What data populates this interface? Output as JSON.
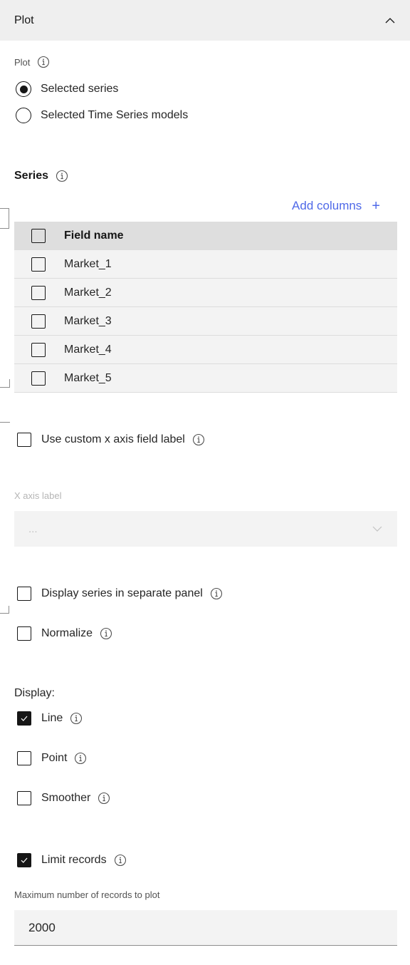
{
  "accordion": {
    "title": "Plot",
    "expanded": true,
    "toggle_icon": "chevron-up-icon"
  },
  "plot_group": {
    "label": "Plot",
    "info_icon": "info-icon",
    "options": [
      {
        "label": "Selected series",
        "selected": true
      },
      {
        "label": "Selected Time Series models",
        "selected": false
      }
    ]
  },
  "series": {
    "heading": "Series",
    "info_icon": "info-icon",
    "add_columns_label": "Add columns",
    "add_columns_icon": "plus-icon",
    "table": {
      "header": "Field name",
      "header_checked": false,
      "rows": [
        {
          "name": "Market_1",
          "checked": false
        },
        {
          "name": "Market_2",
          "checked": false
        },
        {
          "name": "Market_3",
          "checked": false
        },
        {
          "name": "Market_4",
          "checked": false
        },
        {
          "name": "Market_5",
          "checked": false
        }
      ]
    }
  },
  "custom_x_axis": {
    "label": "Use custom x axis field label",
    "checked": false
  },
  "x_axis_label": {
    "label": "X axis label",
    "placeholder": "...",
    "disabled": true
  },
  "separate_panel": {
    "label": "Display series in separate panel",
    "checked": false
  },
  "normalize": {
    "label": "Normalize",
    "checked": false
  },
  "display": {
    "label": "Display:",
    "options": [
      {
        "label": "Line",
        "checked": true
      },
      {
        "label": "Point",
        "checked": false
      },
      {
        "label": "Smoother",
        "checked": false
      }
    ]
  },
  "limit_records": {
    "label": "Limit records",
    "checked": true
  },
  "max_records": {
    "label": "Maximum number of records to plot",
    "value": "2000"
  }
}
